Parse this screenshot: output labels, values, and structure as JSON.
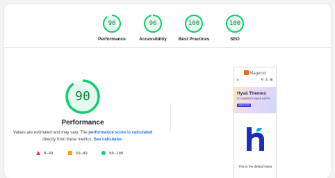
{
  "categories": [
    {
      "score": "90",
      "label": "Performance",
      "fraction": 0.9
    },
    {
      "score": "96",
      "label": "Accessibility",
      "fraction": 0.96
    },
    {
      "score": "100",
      "label": "Best Practices",
      "fraction": 1.0
    },
    {
      "score": "100",
      "label": "SEO",
      "fraction": 1.0
    }
  ],
  "main": {
    "score": "90",
    "fraction": 0.9,
    "title": "Performance",
    "desc_part1": "Values are estimated and may vary. The ",
    "desc_link1": "performance score is calculated",
    "desc_part2": " directly from these metrics. ",
    "desc_link2": "See calculator."
  },
  "legend": [
    {
      "range": "0–49",
      "shape": "triangle",
      "color": "#ff3333"
    },
    {
      "range": "50–89",
      "shape": "square",
      "color": "#ffa400"
    },
    {
      "range": "90–100",
      "shape": "circle",
      "color": "#0cce6b"
    }
  ],
  "colors": {
    "pass": "#0cce6b",
    "pass_text": "#0c7d3e",
    "link": "#1a73e8"
  },
  "screenshot": {
    "brand": "Magento",
    "hero_title": "Hyvä Themes",
    "hero_subtitle": "ECOMMERCE MADE HAPPY",
    "hero_button": "ABOUT HYVÄ",
    "caption": "This is the default Hyvä"
  }
}
